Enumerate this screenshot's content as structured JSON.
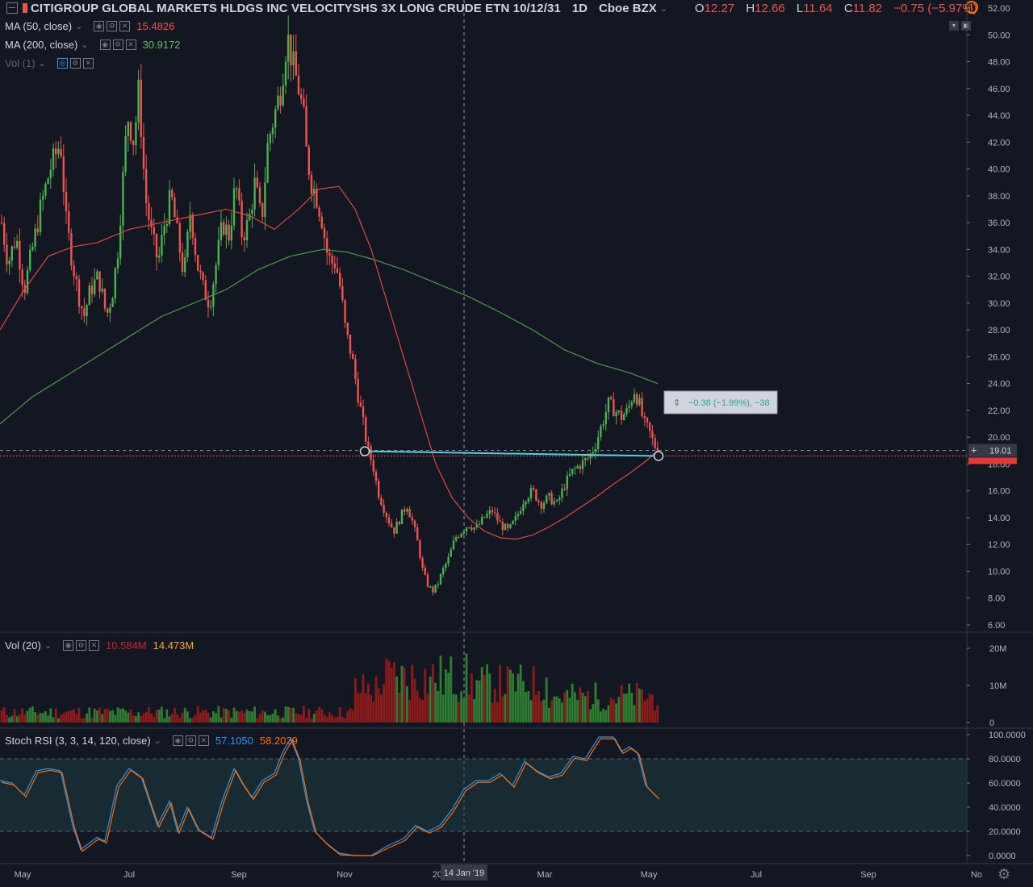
{
  "header": {
    "symbol_title": "CITIGROUP GLOBAL MARKETS HLDGS INC VELOCITYSHS 3X LONG CRUDE ETN 10/12/31",
    "interval": "1D",
    "exchange": "Cboe BZX",
    "ohlc": {
      "o_label": "O",
      "o": "12.27",
      "h_label": "H",
      "h": "12.66",
      "l_label": "L",
      "l": "11.64",
      "c_label": "C",
      "c": "11.82"
    },
    "change": "−0.75 (−5.97%)"
  },
  "indicators": {
    "ma50": {
      "label": "MA (50, close)",
      "value": "15.4826",
      "color": "#ef5350"
    },
    "ma200": {
      "label": "MA (200, close)",
      "value": "30.9172",
      "color": "#66bb6a"
    },
    "vol_overlay": {
      "label": "Vol (1)"
    },
    "vol20": {
      "label": "Vol (20)",
      "value1": "10.584M",
      "value1_color": "#c62828",
      "value2": "14.473M",
      "value2_color": "#ffa726"
    },
    "stoch": {
      "label": "Stoch RSI (3, 3, 14, 120, close)",
      "k": "57.1050",
      "k_color": "#2196f3",
      "d": "58.2029",
      "d_color": "#ff6d00"
    }
  },
  "icons": {
    "pane_toggle": "collapse-icon",
    "settings": "gear-icon",
    "alert": "warning-icon"
  },
  "colors": {
    "up": "#4caf50",
    "down": "#ef5350",
    "ma50": "#e0473f",
    "ma200": "#4e9a47",
    "measure": "#4dd0e1",
    "bg": "#131722"
  },
  "measure_label": "−0.38 (−1.99%), −38",
  "crosshair_label": "14 Jan '19",
  "price_badge": "19.01",
  "chart_data": [
    {
      "type": "candlestick",
      "title": "CITIGROUP GLOBAL MARKETS HLDGS INC VELOCITYSHS 3X LONG CRUDE ETN 10/12/31",
      "x": [
        "May",
        "Jul",
        "Sep",
        "Nov",
        "Jan",
        "Mar",
        "May",
        "Jul",
        "Sep",
        "No"
      ],
      "x_ticks": [
        "May",
        "Jul",
        "Sep",
        "Nov",
        "2019",
        "Mar",
        "May",
        "Jul",
        "Sep",
        "No"
      ],
      "y_ticks": [
        "52.00",
        "50.00",
        "48.00",
        "46.00",
        "44.00",
        "42.00",
        "40.00",
        "38.00",
        "36.00",
        "34.00",
        "32.00",
        "30.00",
        "28.00",
        "26.00",
        "24.00",
        "22.00",
        "20.00",
        "18.00",
        "16.00",
        "14.00",
        "12.00",
        "10.00",
        "8.00",
        "6.00"
      ],
      "ylim": [
        5.5,
        52.5
      ],
      "close_path": [
        [
          0,
          36
        ],
        [
          4,
          33
        ],
        [
          8,
          34.5
        ],
        [
          12,
          31
        ],
        [
          16,
          32
        ],
        [
          20,
          30.5
        ],
        [
          24,
          28
        ],
        [
          28,
          25
        ],
        [
          32,
          23
        ],
        [
          36,
          21
        ],
        [
          40,
          19
        ],
        [
          45,
          17.5
        ],
        [
          50,
          16.5
        ],
        [
          55,
          15.5
        ],
        [
          60,
          15
        ],
        [
          65,
          13.5
        ],
        [
          70,
          12.5
        ],
        [
          75,
          14
        ],
        [
          80,
          13.5
        ],
        [
          85,
          14.2
        ],
        [
          90,
          15
        ],
        [
          95,
          14
        ],
        [
          100,
          13
        ],
        [
          104,
          13.5
        ],
        [
          108,
          14.5
        ],
        [
          112,
          15.5
        ],
        [
          116,
          16.5
        ],
        [
          120,
          17.2
        ],
        [
          124,
          18
        ],
        [
          128,
          19
        ],
        [
          132,
          20
        ],
        [
          136,
          21.5
        ],
        [
          140,
          22
        ],
        [
          144,
          21.5
        ],
        [
          148,
          22
        ],
        [
          152,
          23
        ],
        [
          155,
          24
        ],
        [
          158,
          22
        ],
        [
          161,
          19
        ]
      ],
      "ma50_path": [
        [
          0,
          28
        ],
        [
          40,
          36
        ],
        [
          80,
          38.7
        ],
        [
          100,
          33
        ],
        [
          120,
          20
        ],
        [
          140,
          13
        ],
        [
          155,
          12.5
        ],
        [
          180,
          17
        ],
        [
          200,
          21
        ],
        [
          210,
          19
        ]
      ],
      "ma200_path": [
        [
          0,
          21
        ],
        [
          50,
          31
        ],
        [
          100,
          34
        ],
        [
          150,
          29
        ],
        [
          200,
          26
        ],
        [
          210,
          24
        ]
      ],
      "ma50_value": 15.4826,
      "ma200_value": 30.9172,
      "last_price": 19.01,
      "measure": {
        "start": 18.9,
        "end": 18.6,
        "label": "−0.38 (−1.99%), −38"
      }
    },
    {
      "type": "bar",
      "title": "Vol (20)",
      "y_ticks": [
        "20M",
        "10M",
        "0"
      ],
      "ylim": [
        0,
        22
      ],
      "series": [
        {
          "name": "10.584M",
          "values": "volume bars (green = up day, red = down day)"
        }
      ]
    },
    {
      "type": "line",
      "title": "Stoch RSI (3, 3, 14, 120, close)",
      "y_ticks": [
        "100.0000",
        "80.0000",
        "60.0000",
        "40.0000",
        "20.0000",
        "0.0000"
      ],
      "ylim": [
        0,
        100
      ],
      "band": [
        20,
        80
      ],
      "k_last": 57.105,
      "d_last": 58.2029
    }
  ]
}
